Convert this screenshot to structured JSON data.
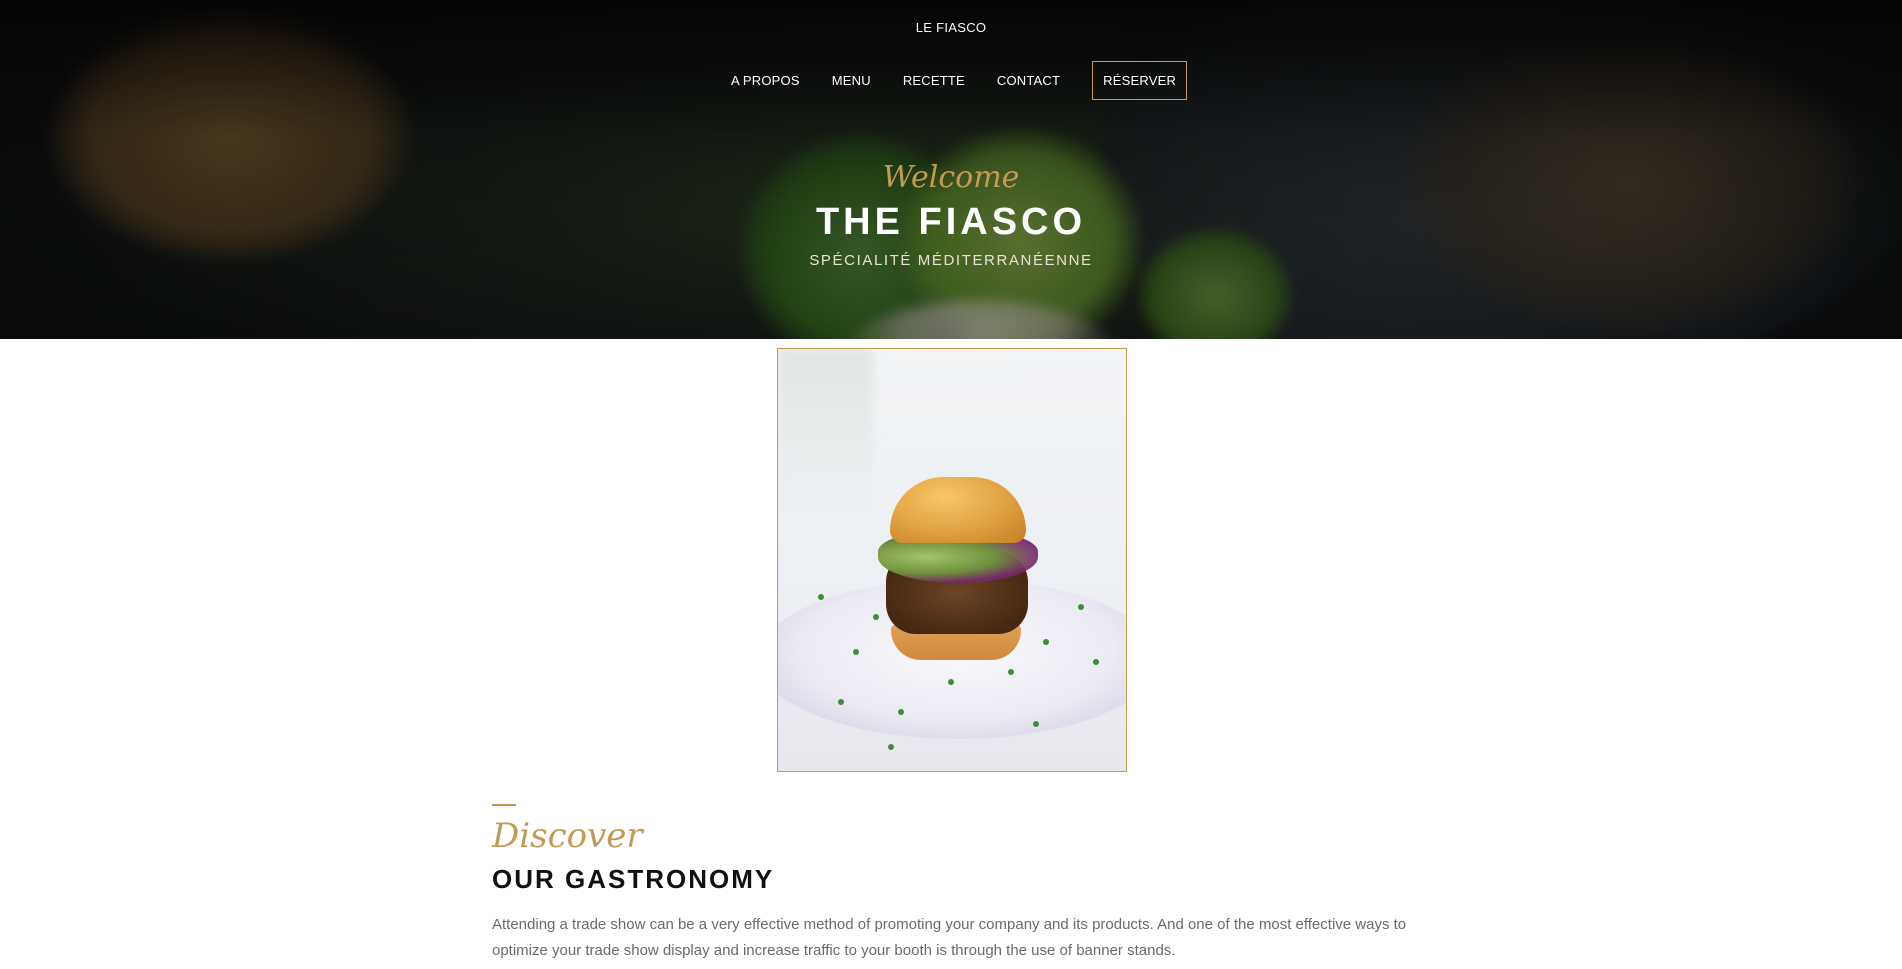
{
  "header": {
    "brand": "LE FIASCO",
    "nav": [
      {
        "label": "A PROPOS"
      },
      {
        "label": "MENU"
      },
      {
        "label": "RECETTE"
      },
      {
        "label": "CONTACT"
      }
    ],
    "reserve_label": "RÉSERVER"
  },
  "hero": {
    "script_text": "Welcome",
    "title": "THE FIASCO",
    "subtitle": "SPÉCIALITÉ MÉDITERRANÉENNE"
  },
  "section": {
    "script_text": "Discover",
    "heading": "OUR GASTRONOMY",
    "paragraph": "Attending a trade show can be a very effective method of promoting your company and its products. And one of the most effective ways to optimize your trade show display and increase traffic to your booth is through the use of banner stands."
  },
  "colors": {
    "accent": "#c49a52",
    "heading": "#111111",
    "body_text": "#6a6a6a"
  }
}
